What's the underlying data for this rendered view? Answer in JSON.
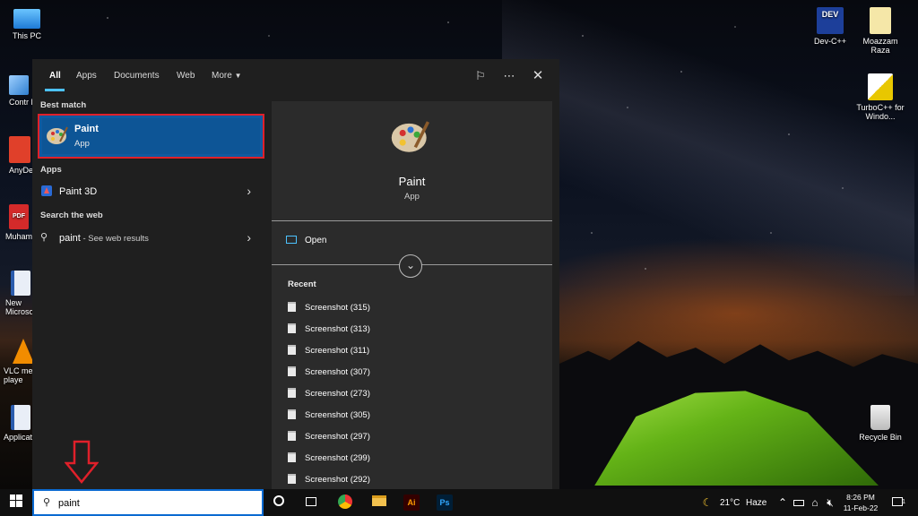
{
  "desktop": {
    "icons_left": [
      {
        "label": "This PC"
      },
      {
        "label": "Contr Pane"
      },
      {
        "label": "AnyDe"
      },
      {
        "label": "Muham"
      },
      {
        "label": "New Microso"
      },
      {
        "label": "VLC me playe"
      },
      {
        "label": "Applicat"
      }
    ],
    "icons_right": [
      {
        "label": "Dev-C++"
      },
      {
        "label": "Moazzam Raza"
      },
      {
        "label": "TurboC++ for Windo..."
      },
      {
        "label": "Recycle Bin"
      }
    ]
  },
  "start_menu": {
    "tabs": [
      "All",
      "Apps",
      "Documents",
      "Web",
      "More"
    ],
    "active_tab": "All",
    "best_match_label": "Best match",
    "best_match": {
      "title": "Paint",
      "subtitle": "App"
    },
    "apps_label": "Apps",
    "apps": [
      {
        "label": "Paint 3D"
      }
    ],
    "web_label": "Search the web",
    "web_result": {
      "query": "paint",
      "suffix": " - See web results"
    },
    "detail": {
      "title": "Paint",
      "subtitle": "App",
      "open_label": "Open",
      "recent_label": "Recent",
      "recent": [
        "Screenshot (315)",
        "Screenshot (313)",
        "Screenshot (311)",
        "Screenshot (307)",
        "Screenshot (273)",
        "Screenshot (305)",
        "Screenshot (297)",
        "Screenshot (299)",
        "Screenshot (292)"
      ]
    }
  },
  "taskbar": {
    "search_value": "paint",
    "weather": "21°C",
    "weather_desc": "Haze",
    "time": "8:26 PM",
    "date": "11-Feb-22",
    "notification_count": "1"
  },
  "colors": {
    "accent": "#0f5aa0",
    "highlight_border": "#e0202a",
    "tab_underline": "#4cc2ff"
  }
}
